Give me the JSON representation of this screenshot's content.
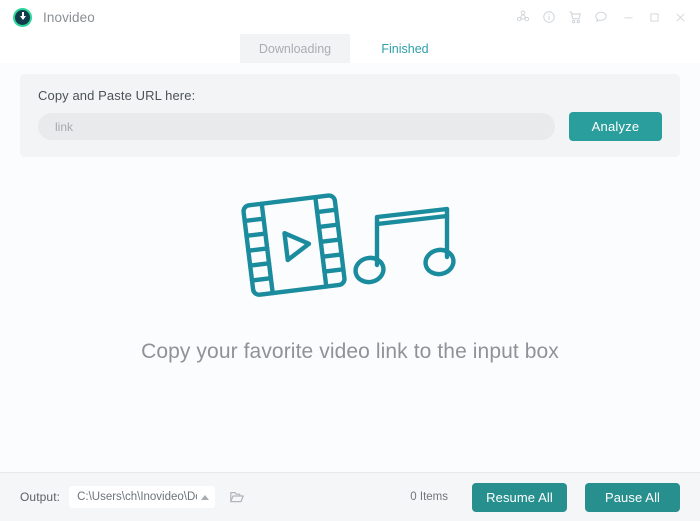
{
  "window": {
    "app_name": "Inovideo",
    "logo_icon": "download-circle-icon",
    "controls": [
      {
        "name": "settings-icon",
        "glyph": "gear"
      },
      {
        "name": "info-icon",
        "glyph": "info"
      },
      {
        "name": "cart-icon",
        "glyph": "cart"
      },
      {
        "name": "feedback-icon",
        "glyph": "chat"
      },
      {
        "name": "minimize-button",
        "glyph": "minimize"
      },
      {
        "name": "maximize-button",
        "glyph": "maximize"
      },
      {
        "name": "close-button",
        "glyph": "close"
      }
    ]
  },
  "tabs": [
    {
      "label": "Downloading",
      "active": false
    },
    {
      "label": "Finished",
      "active": true
    }
  ],
  "url_panel": {
    "label": "Copy and Paste URL here:",
    "input_value": "",
    "input_placeholder": "link",
    "analyze_label": "Analyze"
  },
  "empty_state": {
    "message": "Copy your favorite video link to the input box",
    "art_video_icon": "film-strip-play-icon",
    "art_music_icon": "music-note-icon"
  },
  "bottom_bar": {
    "output_label": "Output:",
    "output_path": "C:\\Users\\ch\\Inovideo\\Downl",
    "caret_icon": "chevron-up-icon",
    "folder_icon": "folder-open-icon",
    "items_count": "0 Items",
    "resume_all_label": "Resume All",
    "pause_all_label": "Pause All"
  },
  "colors": {
    "accent_teal": "#2a9d9d",
    "button_teal": "#27908f",
    "logo_green": "#2bd69a",
    "tab_active_text": "#2f9faa",
    "illustration": "#1a8c9e",
    "panel_gray": "#f3f4f5",
    "bottom_bar": "#f5f6f7"
  }
}
